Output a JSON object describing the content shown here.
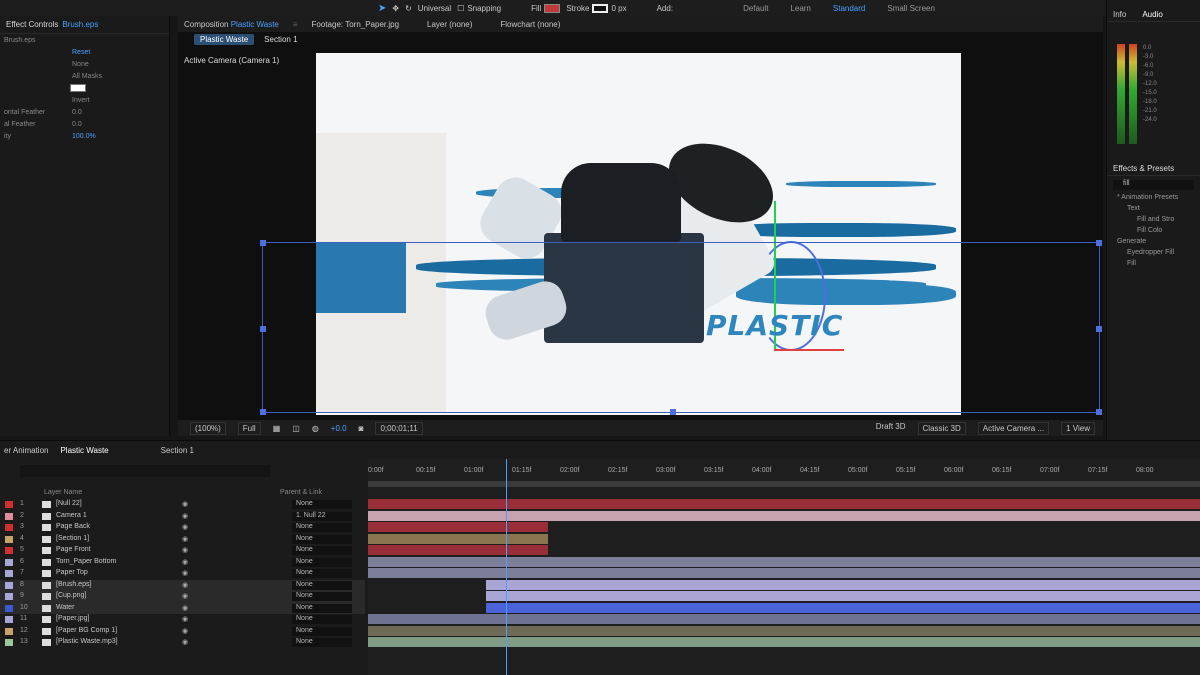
{
  "toolbar": {
    "universal_label": "Universal",
    "snapping_label": "Snapping",
    "fill_label": "Fill",
    "stroke_label": "Stroke",
    "stroke_value": "0 px",
    "add_label": "Add:",
    "workspaces": [
      "Default",
      "Learn",
      "Standard",
      "Small Screen"
    ],
    "active_workspace": "Standard"
  },
  "effect_controls": {
    "tab_label": "Effect Controls",
    "layer": "Brush.eps",
    "layer_row": "Brush.eps",
    "reset_label": "Reset",
    "rows": [
      {
        "label": "",
        "value": "None",
        "grey": true
      },
      {
        "label": "",
        "value": "All Masks",
        "grey": true
      },
      {
        "label": "",
        "value": "",
        "grey": true
      },
      {
        "label": "",
        "value": "Invert",
        "grey": true
      },
      {
        "label": "ontal Feather",
        "value": "0.0",
        "grey": true
      },
      {
        "label": "al Feather",
        "value": "0.0",
        "grey": true
      },
      {
        "label": "ity",
        "value": "100.0%",
        "grey": false
      }
    ]
  },
  "composition": {
    "tab_label": "Composition",
    "comp_name": "Plastic Waste",
    "footage_label": "Footage: Torn_Paper.jpg",
    "layer_label": "Layer (none)",
    "flowchart_label": "Flowchart (none)",
    "sub_tab_active": "Plastic Waste",
    "sub_tab_other": "Section 1",
    "camera_label": "Active Camera (Camera 1)",
    "canvas_text": "PLASTIC"
  },
  "viewer_footer": {
    "zoom": "(100%)",
    "resolution": "Full",
    "exposure": "+0.0",
    "timecode": "0;00;01;11",
    "renderer_draft": "Draft 3D",
    "renderer": "Classic 3D",
    "camera": "Active Camera ...",
    "view": "1 View"
  },
  "right_panel": {
    "info_tab": "Info",
    "audio_tab": "Audio",
    "db_scale": [
      "0.0",
      "-3.0",
      "-6.0",
      "-9.0",
      "-12.0",
      "-15.0",
      "-18.0",
      "-21.0",
      "-24.0"
    ],
    "effects_title": "Effects & Presets",
    "search_value": "fill",
    "tree": [
      {
        "label": "* Animation Presets",
        "level": 1
      },
      {
        "label": "Text",
        "level": 2
      },
      {
        "label": "Fill and Stro",
        "level": 3
      },
      {
        "label": "Fill Colo",
        "level": 3
      },
      {
        "label": "Generate",
        "level": 1
      },
      {
        "label": "Eyedropper Fill",
        "level": 2
      },
      {
        "label": "Fill",
        "level": 2
      }
    ]
  },
  "timeline": {
    "tabs": [
      "er Animation",
      "Plastic Waste",
      "Section 1"
    ],
    "active_tab": "Plastic Waste",
    "header": {
      "layer_name": "Layer Name",
      "parent": "Parent & Link"
    },
    "layers": [
      {
        "num": "1",
        "name": "[Null 22]",
        "color": "#d03030",
        "parent": "None"
      },
      {
        "num": "2",
        "name": "Camera 1",
        "color": "#e08a9a",
        "parent": "1. Null 22"
      },
      {
        "num": "3",
        "name": "Page Back",
        "color": "#d03030",
        "parent": "None"
      },
      {
        "num": "4",
        "name": "[Section 1]",
        "color": "#c9a46a",
        "parent": "None"
      },
      {
        "num": "5",
        "name": "Page Front",
        "color": "#d03030",
        "parent": "None"
      },
      {
        "num": "6",
        "name": "Torn_Paper Bottom",
        "color": "#a8a8d8",
        "parent": "None"
      },
      {
        "num": "7",
        "name": "Paper Top",
        "color": "#a8a8d8",
        "parent": "None"
      },
      {
        "num": "8",
        "name": "[Brush.eps]",
        "color": "#a8a8d8",
        "parent": "None"
      },
      {
        "num": "9",
        "name": "[Cup.png]",
        "color": "#a8a8d8",
        "parent": "None"
      },
      {
        "num": "10",
        "name": "Water",
        "color": "#3c5ad0",
        "parent": "None"
      },
      {
        "num": "11",
        "name": "[Paper.jpg]",
        "color": "#a8a8d8",
        "parent": "None"
      },
      {
        "num": "12",
        "name": "[Paper BG Comp 1]",
        "color": "#c9a46a",
        "parent": "None"
      },
      {
        "num": "13",
        "name": "[Plastic Waste.mp3]",
        "color": "#9ac89a",
        "parent": "None"
      }
    ],
    "ruler": [
      "0:00f",
      "00:15f",
      "01:00f",
      "01:15f",
      "02:00f",
      "02:15f",
      "03:00f",
      "03:15f",
      "04:00f",
      "04:15f",
      "05:00f",
      "05:15f",
      "06:00f",
      "06:15f",
      "07:00f",
      "07:15f",
      "08:00"
    ]
  },
  "colors": {
    "accent": "#4aa0ff",
    "fill_swatch": "#c03a3a",
    "text_blue": "#2f86bd",
    "water_bar": "#4a63d8",
    "red_bar": "#a8313a"
  }
}
